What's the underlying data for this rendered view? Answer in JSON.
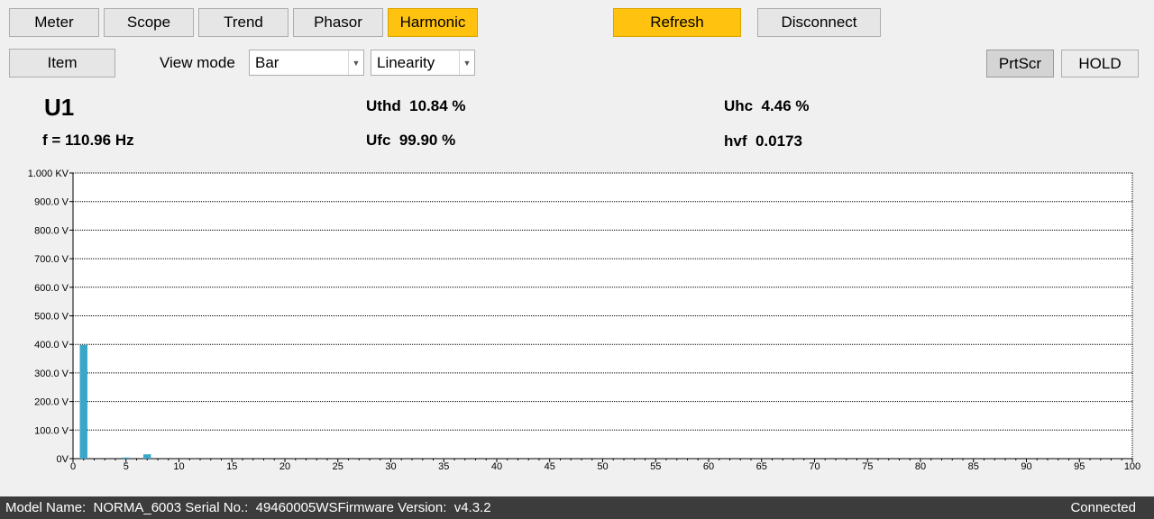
{
  "tabs": [
    {
      "label": "Meter",
      "active": false
    },
    {
      "label": "Scope",
      "active": false
    },
    {
      "label": "Trend",
      "active": false
    },
    {
      "label": "Phasor",
      "active": false
    },
    {
      "label": "Harmonic",
      "active": true
    }
  ],
  "toolbar": {
    "refresh_label": "Refresh",
    "disconnect_label": "Disconnect",
    "item_label": "Item",
    "view_mode_label": "View mode",
    "view_mode_value": "Bar",
    "scale_value": "Linearity",
    "prtscr_label": "PrtScr",
    "hold_label": "HOLD",
    "accent_color": "#ffc20e"
  },
  "stats": {
    "channel": "U1",
    "frequency": "f = 110.96 Hz",
    "uthd": "Uthd  10.84 %",
    "ufc": "Ufc  99.90 %",
    "uhc": "Uhc  4.46 %",
    "hvf": "hvf  0.0173"
  },
  "chart_data": {
    "type": "bar",
    "title": "",
    "xlabel": "",
    "ylabel": "",
    "xlim": [
      0,
      100
    ],
    "ylim": [
      0,
      1000
    ],
    "grid": true,
    "bar_color": "#3aa7c9",
    "y_ticks": [
      0,
      100,
      200,
      300,
      400,
      500,
      600,
      700,
      800,
      900,
      1000
    ],
    "y_tick_labels": [
      "0V",
      "100.0 V",
      "200.0 V",
      "300.0 V",
      "400.0 V",
      "500.0 V",
      "600.0 V",
      "700.0 V",
      "800.0 V",
      "900.0 V",
      "1.000 KV"
    ],
    "x_ticks": [
      0,
      5,
      10,
      15,
      20,
      25,
      30,
      35,
      40,
      45,
      50,
      55,
      60,
      65,
      70,
      75,
      80,
      85,
      90,
      95,
      100
    ],
    "x_tick_labels": [
      "0",
      "5",
      "10",
      "15",
      "20",
      "25",
      "30",
      "35",
      "40",
      "45",
      "50",
      "55",
      "60",
      "65",
      "70",
      "75",
      "80",
      "85",
      "90",
      "95",
      "100"
    ],
    "categories": [
      1,
      5,
      7
    ],
    "values": [
      398,
      4,
      15
    ]
  },
  "status_bar": {
    "info": "Model Name:  NORMA_6003 Serial No.:  49460005WSFirmware Version:  v4.3.2",
    "connection": "Connected"
  }
}
